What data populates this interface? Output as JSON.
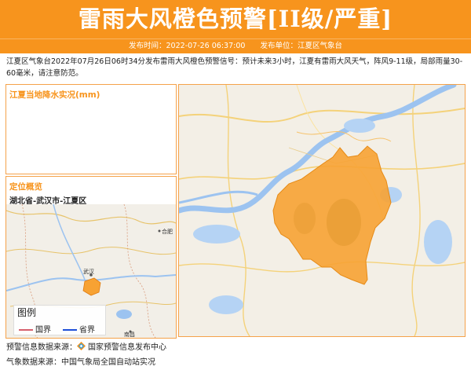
{
  "header": {
    "title": "雷雨大风橙色预警[II级/严重]",
    "publish_time": "发布时间：2022-07-26 06:37:00",
    "publish_unit": "发布单位：江夏区气象台"
  },
  "description": "江夏区气象台2022年07月26日06时34分发布雷雨大风橙色预警信号：预计未来3小时，江夏有雷雨大风天气，阵风9-11级，局部雨量30-60毫米，请注意防范。",
  "rain_panel": {
    "title": "江夏当地降水实况(mm)"
  },
  "location_panel": {
    "title": "定位概览",
    "region": "湖北省-武汉市-江夏区",
    "map_labels": {
      "wuhan": "武汉",
      "hefei": "合肥",
      "nanchang": "南昌"
    }
  },
  "legend": {
    "title": "图例",
    "items": [
      {
        "label": "国界",
        "color": "#d6606d"
      },
      {
        "label": "省界",
        "color": "#1e4fd8"
      }
    ]
  },
  "colors": {
    "accent": "#f7941d",
    "warning_area": "#f7a233",
    "water": "#9cc3f0",
    "land": "#f3efe6"
  },
  "sources": {
    "warning_prefix": "预警信息数据来源：",
    "warning_source": "国家预警信息发布中心",
    "weather": "气象数据来源：中国气象局全国自动站实况"
  },
  "icons": {
    "source_logo": "diamond-logo-icon"
  }
}
